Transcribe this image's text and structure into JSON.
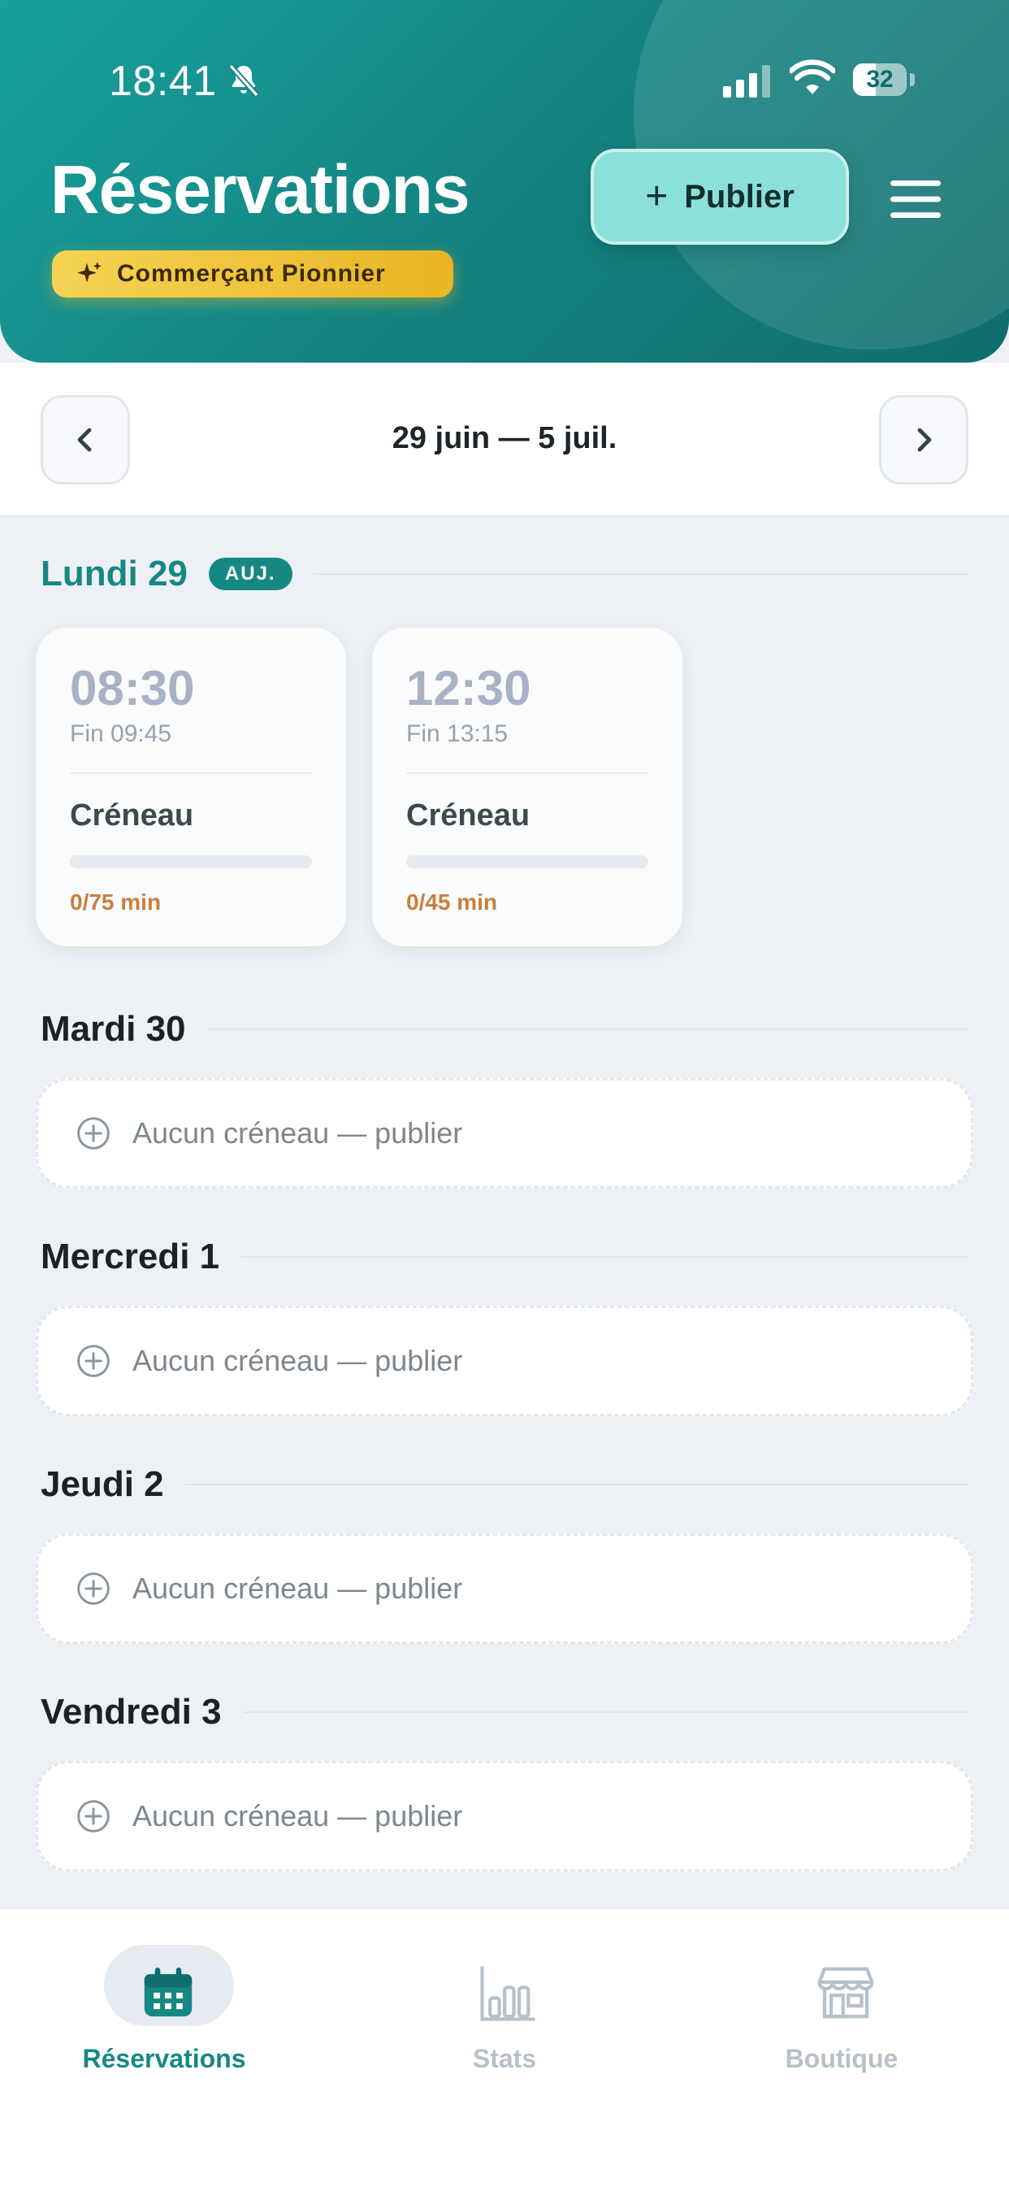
{
  "status_bar": {
    "time": "18:41",
    "battery": "32"
  },
  "header": {
    "title": "Réservations",
    "badge": "Commerçant Pionnier",
    "publish_label": "Publier",
    "publish_plus": "+"
  },
  "week": {
    "label": "29 juin — 5 juil."
  },
  "days": [
    {
      "name": "Lundi 29",
      "today_badge": "AUJ.",
      "slots": [
        {
          "time": "08:30",
          "end": "Fin 09:45",
          "title": "Créneau",
          "booked": "0/75 min",
          "fill": 0
        },
        {
          "time": "12:30",
          "end": "Fin 13:15",
          "title": "Créneau",
          "booked": "0/45 min",
          "fill": 0
        }
      ]
    },
    {
      "name": "Mardi 30",
      "empty_text": "Aucun créneau — publier"
    },
    {
      "name": "Mercredi 1",
      "empty_text": "Aucun créneau — publier"
    },
    {
      "name": "Jeudi 2",
      "empty_text": "Aucun créneau — publier"
    },
    {
      "name": "Vendredi 3",
      "empty_text": "Aucun créneau — publier"
    }
  ],
  "tabbar": {
    "items": [
      {
        "label": "Réservations",
        "icon": "calendar-icon",
        "active": true
      },
      {
        "label": "Stats",
        "icon": "bar-chart-icon",
        "active": false
      },
      {
        "label": "Boutique",
        "icon": "shop-icon",
        "active": false
      }
    ]
  },
  "colors": {
    "primary": "#168883",
    "header_start": "#17a09d",
    "header_end": "#0f6d6c",
    "badge_gold": "#f0c33a",
    "publish_bg": "#8ce0dc",
    "minutes_orange": "#c77f3d",
    "inactive_tab": "#b8c0ca"
  }
}
